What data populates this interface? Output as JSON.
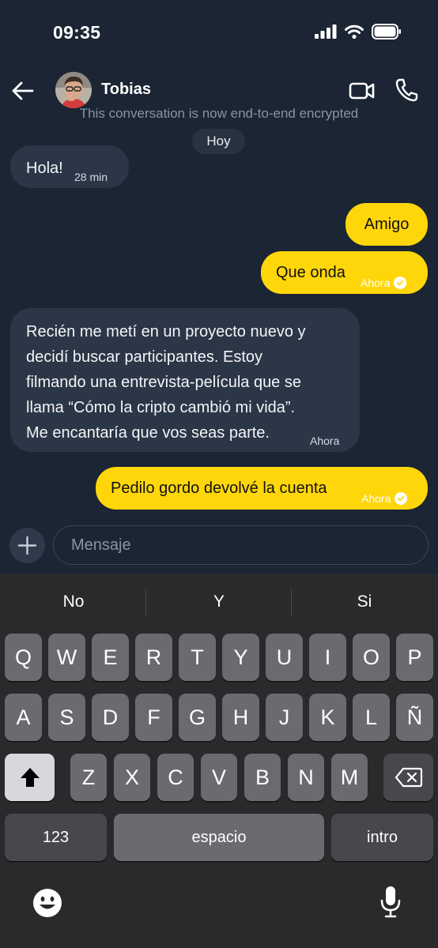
{
  "status": {
    "time": "09:35"
  },
  "header": {
    "contact_name": "Tobias"
  },
  "encryption_note": "This conversation is now end-to-end encrypted",
  "date_chip": "Hoy",
  "messages": [
    {
      "direction": "in",
      "text": "Hola!",
      "time": "28 min"
    },
    {
      "direction": "out",
      "text": "Amigo"
    },
    {
      "direction": "out",
      "text": "Que onda",
      "time": "Ahora",
      "read": true
    },
    {
      "direction": "in",
      "lines": [
        "Recién me metí en un proyecto nuevo y",
        "decidí buscar participantes. Estoy",
        "filmando una entrevista-película que se",
        "llama “Cómo la cripto cambió mi vida”.",
        "Me encantaría que vos seas parte."
      ],
      "time": "Ahora"
    },
    {
      "direction": "out",
      "text": "Pedilo gordo devolvé la cuenta",
      "time": "Ahora",
      "read": true
    }
  ],
  "composer": {
    "placeholder": "Mensaje"
  },
  "keyboard": {
    "suggestions": [
      "No",
      "Y",
      "Si"
    ],
    "row1": [
      "Q",
      "W",
      "E",
      "R",
      "T",
      "Y",
      "U",
      "I",
      "O",
      "P"
    ],
    "row2": [
      "A",
      "S",
      "D",
      "F",
      "G",
      "H",
      "J",
      "K",
      "L",
      "Ñ"
    ],
    "row3": [
      "Z",
      "X",
      "C",
      "V",
      "B",
      "N",
      "M"
    ],
    "numbers_label": "123",
    "space_label": "espacio",
    "return_label": "intro"
  },
  "icons": {
    "back": "arrow-left-icon",
    "video": "video-camera-icon",
    "phone": "phone-icon",
    "plus": "plus-icon",
    "shift": "shift-icon",
    "delete": "backspace-icon",
    "emoji": "emoji-icon",
    "dictation": "microphone-icon"
  },
  "colors": {
    "background": "#1b2533",
    "incoming_bubble": "#2b3646",
    "outgoing_bubble": "#ffd60a",
    "keyboard": "#2a2a2c"
  }
}
